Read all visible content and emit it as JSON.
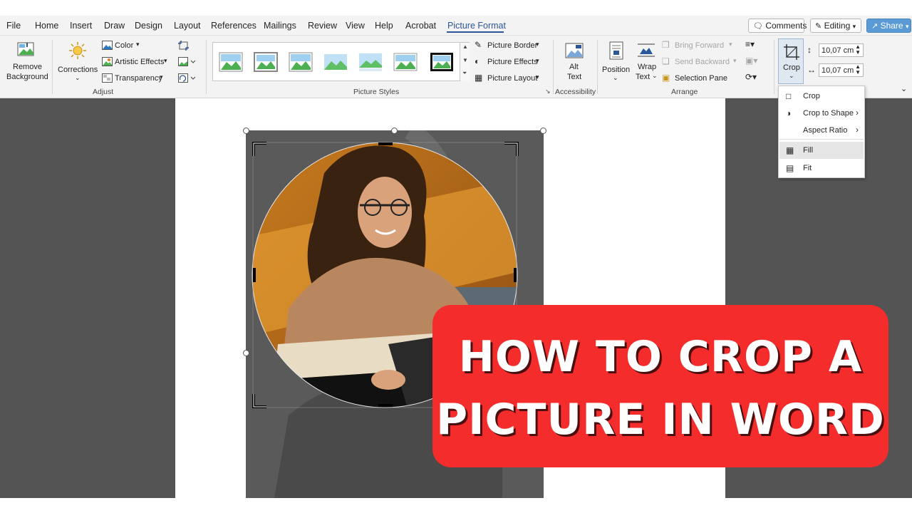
{
  "tabs": [
    "File",
    "Home",
    "Insert",
    "Draw",
    "Design",
    "Layout",
    "References",
    "Mailings",
    "Review",
    "View",
    "Help",
    "Acrobat",
    "Picture Format"
  ],
  "active_tab": "Picture Format",
  "top_buttons": {
    "comments": "Comments",
    "editing": "Editing",
    "share": "Share"
  },
  "ribbon": {
    "adjust": {
      "remove_background_line1": "Remove",
      "remove_background_line2": "Background",
      "corrections": "Corrections",
      "color": "Color",
      "artistic_effects": "Artistic Effects",
      "transparency": "Transparency",
      "group_label": "Adjust"
    },
    "picture_styles": {
      "picture_border": "Picture Border",
      "picture_effects": "Picture Effects",
      "picture_layout": "Picture Layout",
      "group_label": "Picture Styles"
    },
    "accessibility": {
      "alt_text_line1": "Alt",
      "alt_text_line2": "Text",
      "group_label": "Accessibility"
    },
    "arrange": {
      "position": "Position",
      "wrap_text_line1": "Wrap",
      "wrap_text_line2": "Text",
      "bring_forward": "Bring Forward",
      "send_backward": "Send Backward",
      "selection_pane": "Selection Pane",
      "group_label": "Arrange"
    },
    "size": {
      "crop": "Crop",
      "height_value": "10,07 cm",
      "width_value": "10,07 cm"
    }
  },
  "crop_menu": {
    "items": [
      "Crop",
      "Crop to Shape",
      "Aspect Ratio",
      "Fill",
      "Fit"
    ]
  },
  "overlay": {
    "line1": "HOW TO CROP A",
    "line2": "PICTURE IN WORD"
  },
  "colors": {
    "accent": "#2b579a",
    "title_bg": "#f42c2c",
    "workspace": "#545454"
  }
}
